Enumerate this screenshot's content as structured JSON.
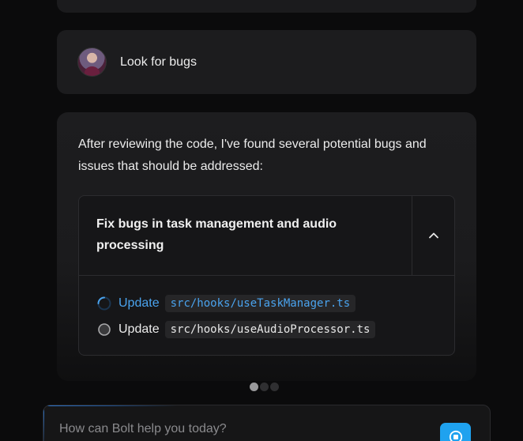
{
  "user_message": {
    "text": "Look for bugs",
    "avatar_icon": "user-avatar"
  },
  "assistant_message": {
    "text": "After reviewing the code, I've found several potential bugs and issues that should be addressed:",
    "artifact": {
      "title": "Fix bugs in task management and audio processing",
      "toggle_icon": "chevron-up-icon",
      "steps": [
        {
          "label": "Update",
          "file": "src/hooks/useTaskManager.ts",
          "status": "in-progress",
          "icon": "spinner-icon"
        },
        {
          "label": "Update",
          "file": "src/hooks/useAudioProcessor.ts",
          "status": "pending",
          "icon": "pending-circle-icon"
        }
      ]
    }
  },
  "pager": {
    "total": 3,
    "active": 1
  },
  "prompt": {
    "placeholder": "How can Bolt help you today?",
    "value": "",
    "action_icon": "stop-icon"
  },
  "colors": {
    "accent": "#1fa2ef",
    "active_step": "#4aa3ee",
    "background": "#0b0b0c",
    "card": "#1c1c1e"
  }
}
